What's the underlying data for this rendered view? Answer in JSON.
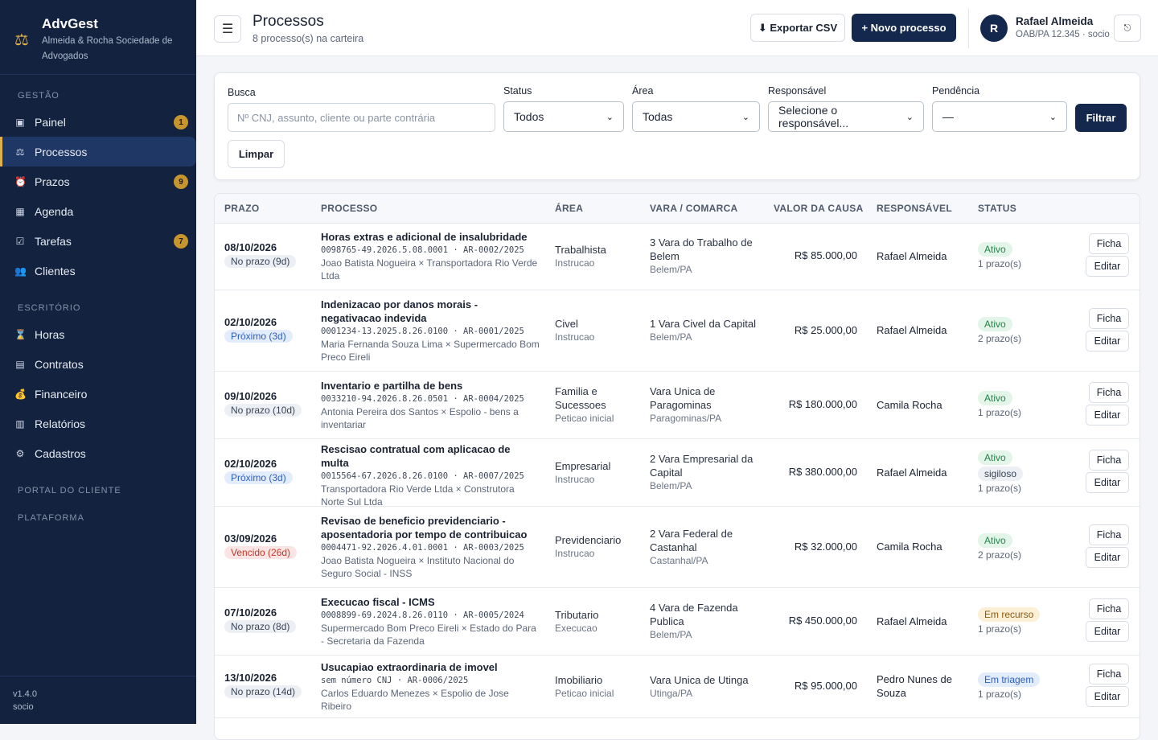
{
  "brand": {
    "name": "AdvGest",
    "subtitle": "Almeida & Rocha Sociedade de Advogados",
    "icon": "scales-icon"
  },
  "sidebar": {
    "sections": [
      {
        "title": "GESTÃO",
        "items": [
          {
            "label": "Painel",
            "icon": "dashboard-icon",
            "badge": "1"
          },
          {
            "label": "Processos",
            "icon": "scales-icon",
            "active": true
          },
          {
            "label": "Prazos",
            "icon": "alarm-icon",
            "badge": "9"
          },
          {
            "label": "Agenda",
            "icon": "calendar-icon"
          },
          {
            "label": "Tarefas",
            "icon": "checkbox-icon",
            "badge": "7"
          },
          {
            "label": "Clientes",
            "icon": "people-icon"
          }
        ]
      },
      {
        "title": "ESCRITÓRIO",
        "items": [
          {
            "label": "Horas",
            "icon": "hourglass-icon"
          },
          {
            "label": "Contratos",
            "icon": "document-icon"
          },
          {
            "label": "Financeiro",
            "icon": "money-bag-icon"
          },
          {
            "label": "Relatórios",
            "icon": "bar-chart-icon"
          },
          {
            "label": "Cadastros",
            "icon": "gear-icon"
          }
        ]
      },
      {
        "title": "PORTAL DO CLIENTE",
        "items": []
      },
      {
        "title": "PLATAFORMA",
        "items": []
      }
    ],
    "footer": {
      "version": "v1.4.0",
      "role": "socio"
    }
  },
  "header": {
    "title": "Processos",
    "subtitle": "8 processo(s) na carteira",
    "export_label": "⬇ Exportar CSV",
    "new_label": "+ Novo processo",
    "user": {
      "initial": "R",
      "name": "Rafael Almeida",
      "role": "OAB/PA 12.345 · socio"
    }
  },
  "filters": {
    "search": {
      "label": "Busca",
      "placeholder": "Nº CNJ, assunto, cliente ou parte contrária"
    },
    "status": {
      "label": "Status",
      "value": "Todos"
    },
    "area": {
      "label": "Área",
      "value": "Todas"
    },
    "responsavel": {
      "label": "Responsável",
      "value": "Selecione o responsável..."
    },
    "pendencia": {
      "label": "Pendência",
      "value": "—"
    },
    "filter_label": "Filtrar",
    "clear_label": "Limpar"
  },
  "table": {
    "columns": [
      "PRAZO",
      "PROCESSO",
      "ÁREA",
      "VARA / COMARCA",
      "VALOR DA CAUSA",
      "RESPONSÁVEL",
      "STATUS"
    ],
    "actions": {
      "ficha": "Ficha",
      "editar": "Editar"
    },
    "rows": [
      {
        "prazo": "08/10/2026",
        "prazo_tag": "No prazo (9d)",
        "prazo_kind": "ok",
        "title": "Horas extras e adicional de insalubridade",
        "number": "0098765-49.2026.5.08.0001 · AR-0002/2025",
        "parts": "Joao Batista Nogueira × Transportadora Rio Verde Ltda",
        "area": "Trabalhista",
        "fase": "Instrucao",
        "vara": "3 Vara do Trabalho de Belem",
        "comarca": "Belem/PA",
        "valor": "R$ 85.000,00",
        "responsavel": "Rafael Almeida",
        "status": "Ativo",
        "status_kind": "ativo",
        "extra": "",
        "prazos": "1 prazo(s)"
      },
      {
        "prazo": "02/10/2026",
        "prazo_tag": "Próximo (3d)",
        "prazo_kind": "soon",
        "title": "Indenizacao por danos morais - negativacao indevida",
        "number": "0001234-13.2025.8.26.0100 · AR-0001/2025",
        "parts": "Maria Fernanda Souza Lima × Supermercado Bom Preco Eireli",
        "area": "Civel",
        "fase": "Instrucao",
        "vara": "1 Vara Civel da Capital",
        "comarca": "Belem/PA",
        "valor": "R$ 25.000,00",
        "responsavel": "Rafael Almeida",
        "status": "Ativo",
        "status_kind": "ativo",
        "extra": "",
        "prazos": "2 prazo(s)"
      },
      {
        "prazo": "09/10/2026",
        "prazo_tag": "No prazo (10d)",
        "prazo_kind": "ok",
        "title": "Inventario e partilha de bens",
        "number": "0033210-94.2026.8.26.0501 · AR-0004/2025",
        "parts": "Antonia Pereira dos Santos × Espolio - bens a inventariar",
        "area": "Familia e Sucessoes",
        "fase": "Peticao inicial",
        "vara": "Vara Unica de Paragominas",
        "comarca": "Paragominas/PA",
        "valor": "R$ 180.000,00",
        "responsavel": "Camila Rocha",
        "status": "Ativo",
        "status_kind": "ativo",
        "extra": "",
        "prazos": "1 prazo(s)"
      },
      {
        "prazo": "02/10/2026",
        "prazo_tag": "Próximo (3d)",
        "prazo_kind": "soon",
        "title": "Rescisao contratual com aplicacao de multa",
        "number": "0015564-67.2026.8.26.0100 · AR-0007/2025",
        "parts": "Transportadora Rio Verde Ltda × Construtora Norte Sul Ltda",
        "area": "Empresarial",
        "fase": "Instrucao",
        "vara": "2 Vara Empresarial da Capital",
        "comarca": "Belem/PA",
        "valor": "R$ 380.000,00",
        "responsavel": "Rafael Almeida",
        "status": "Ativo",
        "status_kind": "ativo",
        "extra": "sigiloso",
        "prazos": "1 prazo(s)"
      },
      {
        "prazo": "03/09/2026",
        "prazo_tag": "Vencido (26d)",
        "prazo_kind": "late",
        "title": "Revisao de beneficio previdenciario - aposentadoria por tempo de contribuicao",
        "number": "0004471-92.2026.4.01.0001 · AR-0003/2025",
        "parts": "Joao Batista Nogueira × Instituto Nacional do Seguro Social - INSS",
        "area": "Previdenciario",
        "fase": "Instrucao",
        "vara": "2 Vara Federal de Castanhal",
        "comarca": "Castanhal/PA",
        "valor": "R$ 32.000,00",
        "responsavel": "Camila Rocha",
        "status": "Ativo",
        "status_kind": "ativo",
        "extra": "",
        "prazos": "2 prazo(s)"
      },
      {
        "prazo": "07/10/2026",
        "prazo_tag": "No prazo (8d)",
        "prazo_kind": "ok",
        "title": "Execucao fiscal - ICMS",
        "number": "0008899-69.2024.8.26.0110 · AR-0005/2024",
        "parts": "Supermercado Bom Preco Eireli × Estado do Para - Secretaria da Fazenda",
        "area": "Tributario",
        "fase": "Execucao",
        "vara": "4 Vara de Fazenda Publica",
        "comarca": "Belem/PA",
        "valor": "R$ 450.000,00",
        "responsavel": "Rafael Almeida",
        "status": "Em recurso",
        "status_kind": "recurso",
        "extra": "",
        "prazos": "1 prazo(s)"
      },
      {
        "prazo": "13/10/2026",
        "prazo_tag": "No prazo (14d)",
        "prazo_kind": "ok",
        "title": "Usucapiao extraordinaria de imovel",
        "number": "sem número CNJ · AR-0006/2025",
        "parts": "Carlos Eduardo Menezes × Espolio de Jose Ribeiro",
        "area": "Imobiliario",
        "fase": "Peticao inicial",
        "vara": "Vara Unica de Utinga",
        "comarca": "Utinga/PA",
        "valor": "R$ 95.000,00",
        "responsavel": "Pedro Nunes de Souza",
        "status": "Em triagem",
        "status_kind": "triagem",
        "extra": "",
        "prazos": "1 prazo(s)"
      }
    ]
  }
}
